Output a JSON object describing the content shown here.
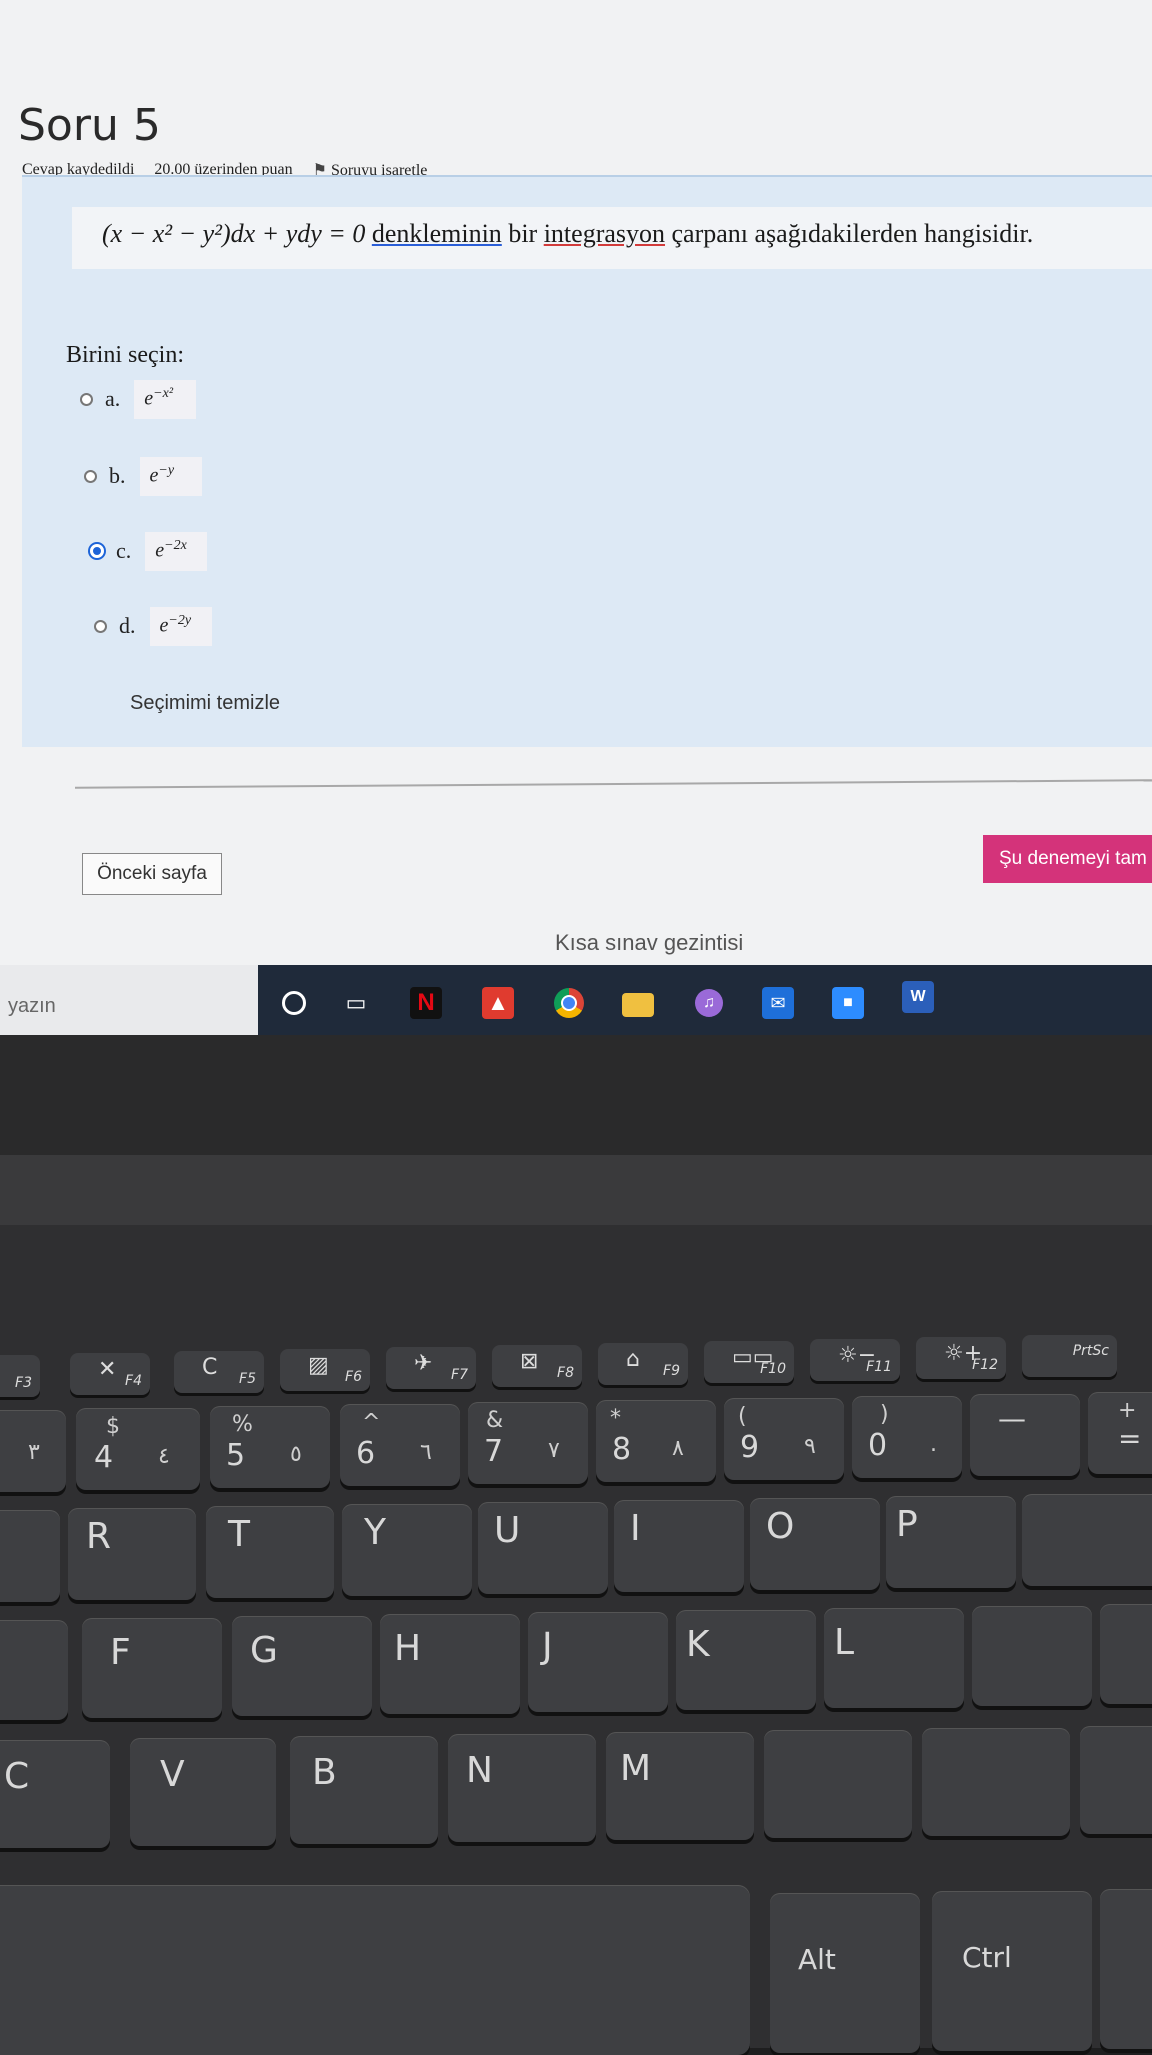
{
  "page": {
    "title": "Soru 5",
    "status": "Cevap kaydedildi",
    "points": "20.00 üzerinden puan",
    "flag_label": "Soruyu işaretle"
  },
  "question": {
    "equation": "(x − x² − y²)dx + ydy = 0",
    "word1": "denkleminin",
    "word2": "bir",
    "word3": "integrasyon",
    "rest": "çarpanı aşağıdakilerden hangisidir."
  },
  "answers": {
    "prompt": "Birini seçin:",
    "options": [
      {
        "label": "a.",
        "base": "e",
        "exp": "−x²",
        "selected": false
      },
      {
        "label": "b.",
        "base": "e",
        "exp": "−y",
        "selected": false
      },
      {
        "label": "c.",
        "base": "e",
        "exp": "−2x",
        "selected": true
      },
      {
        "label": "d.",
        "base": "e",
        "exp": "−2y",
        "selected": false
      }
    ],
    "clear_label": "Seçimimi temizle"
  },
  "navigation": {
    "prev_label": "Önceki sayfa",
    "finish_label": "Şu denemeyi tam",
    "quiz_nav_label": "Kısa sınav gezintisi"
  },
  "taskbar": {
    "search_text": "yazın",
    "icons": [
      "cortana-icon",
      "task-view-icon",
      "netflix-icon",
      "acrobat-icon",
      "chrome-icon",
      "file-explorer-icon",
      "itunes-icon",
      "mail-icon",
      "zoom-icon",
      "word-icon"
    ],
    "netflix_letter": "N",
    "word_letter": "W"
  },
  "keyboard": {
    "fkeys": [
      "F3",
      "F4",
      "F5",
      "F6",
      "F7",
      "F8",
      "F9",
      "F10",
      "F11",
      "F12",
      "PrtSc"
    ],
    "num_row": [
      {
        "main": "4",
        "shift": "$",
        "alt": "٤"
      },
      {
        "main": "5",
        "shift": "%",
        "alt": "٥"
      },
      {
        "main": "6",
        "shift": "^",
        "alt": "٦"
      },
      {
        "main": "7",
        "shift": "&",
        "alt": "٧"
      },
      {
        "main": "8",
        "shift": "*",
        "alt": "٨"
      },
      {
        "main": "9",
        "shift": "(",
        "alt": "٩"
      },
      {
        "main": "0",
        "shift": ")",
        "alt": "."
      },
      {
        "main": "—",
        "shift": "",
        "alt": ""
      },
      {
        "main": "=",
        "shift": "+",
        "alt": ""
      }
    ],
    "top_row": [
      "R",
      "T",
      "Y",
      "U",
      "I",
      "O",
      "P"
    ],
    "home_row": [
      "F",
      "G",
      "H",
      "J",
      "K",
      "L"
    ],
    "bottom_row": [
      "C",
      "V",
      "B",
      "N",
      "M"
    ],
    "alt_label": "Alt",
    "ctrl_label": "Ctrl",
    "prev_key_left": "٣"
  },
  "colors": {
    "question_bg": "#dde9f5",
    "finish_button": "#d4337a",
    "radio_selected": "#1d64d8",
    "taskbar": "#1f2a3a"
  }
}
